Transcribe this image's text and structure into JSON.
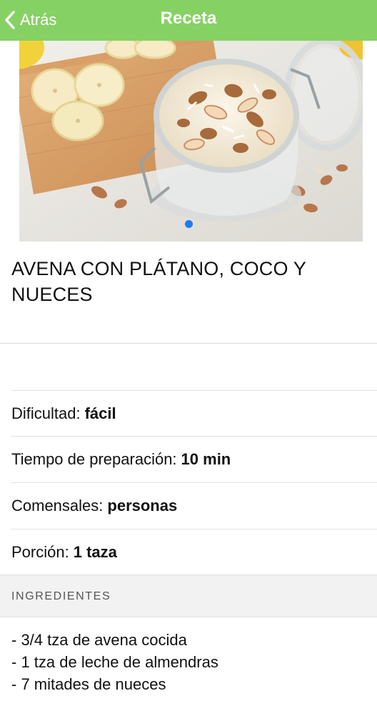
{
  "navbar": {
    "back_label": "Atrás",
    "title": "Receta",
    "color": "#86d164"
  },
  "hero": {
    "slide_dots": 1,
    "active_dot_color": "#1b7cf3"
  },
  "recipe": {
    "title": "AVENA CON PLÁTANO, COCO Y NUECES",
    "details": [
      {
        "label": "Dificultad:",
        "value": "fácil"
      },
      {
        "label": "Tiempo de preparación:",
        "value": "10 min"
      },
      {
        "label": "Comensales:",
        "value": "personas"
      },
      {
        "label": "Porción:",
        "value": "1 taza"
      }
    ],
    "ingredients_header": "INGREDIENTES",
    "ingredients": [
      "- 3/4 tza de avena cocida",
      "- 1 tza de leche de almendras",
      "- 7 mitades de nueces"
    ]
  }
}
